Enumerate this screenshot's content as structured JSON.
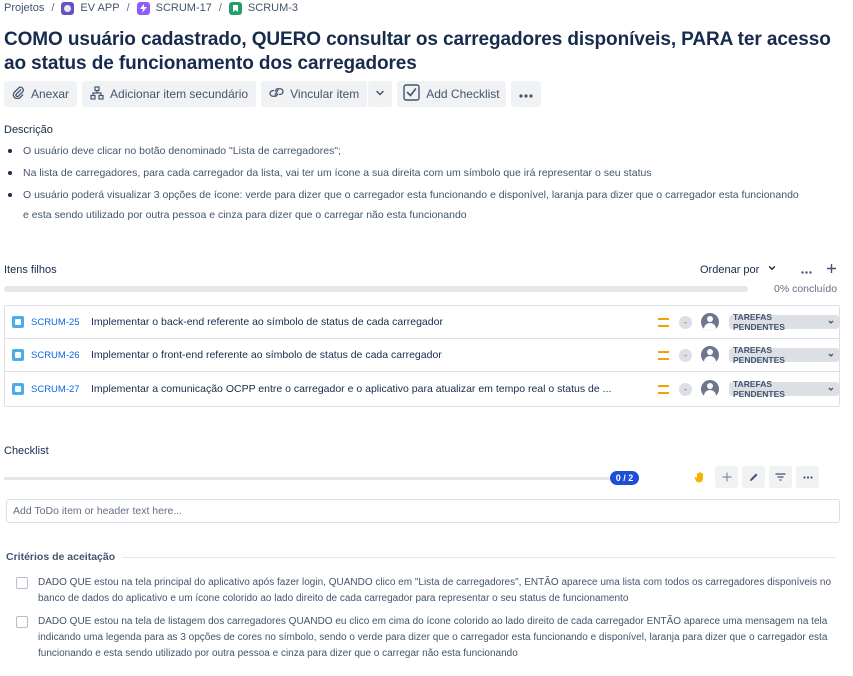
{
  "breadcrumb": {
    "root": "Projetos",
    "project": "EV APP",
    "epic": "SCRUM-17",
    "issue": "SCRUM-3"
  },
  "issue": {
    "title": "COMO usuário cadastrado, QUERO consultar os carregadores disponíveis, PARA ter acesso ao status de funcionamento dos carregadores"
  },
  "toolbar": {
    "attach": "Anexar",
    "add_child": "Adicionar item secundário",
    "link": "Vincular item",
    "add_checklist": "Add Checklist"
  },
  "description": {
    "label": "Descrição",
    "items": [
      "O usuário deve clicar no botão denominado \"Lista de carregadores\";",
      "Na lista de carregadores, para cada carregador da lista, vai ter um ícone a sua direita com um símbolo que irá representar o seu status",
      "O usuário poderá visualizar 3 opções de ícone: verde para dizer que o carregador esta funcionando e disponível, laranja para dizer que o carregador esta funcionando e esta sendo utilizado por outra pessoa e cinza para dizer que o carregar não esta funcionando"
    ]
  },
  "children": {
    "label": "Itens filhos",
    "order_by": "Ordenar por",
    "progress_text": "0% concluído",
    "progress": 0,
    "rows": [
      {
        "key": "SCRUM-25",
        "summary": "Implementar o back-end referente ao símbolo de status de cada carregador",
        "estimate": "-",
        "status": "TAREFAS PENDENTES"
      },
      {
        "key": "SCRUM-26",
        "summary": "Implementar o front-end referente ao símbolo de status de cada carregador",
        "estimate": "-",
        "status": "TAREFAS PENDENTES"
      },
      {
        "key": "SCRUM-27",
        "summary": "Implementar a comunicação OCPP entre o carregador e o aplicativo para atualizar em tempo real o status de ...",
        "estimate": "-",
        "status": "TAREFAS PENDENTES"
      }
    ]
  },
  "checklist": {
    "label": "Checklist",
    "count": "0 / 2",
    "input_placeholder": "Add ToDo item or header text here..."
  },
  "criteria": {
    "label": "Critérios de aceitação",
    "items": [
      "DADO QUE estou na tela principal do aplicativo após fazer login, QUANDO clico em \"Lista de carregadores\", ENTÃO aparece uma lista com todos os carregadores disponíveis no banco de dados do aplicativo e um ícone colorido ao lado direito de cada carregador para representar o seu status de funcionamento",
      "DADO QUE estou na tela de listagem dos carregadores QUANDO eu clico em cima do ícone colorido ao lado direito de cada carregador ENTÃO aparece uma mensagem na tela indicando uma legenda para as 3 opções de cores no símbolo, sendo o verde para dizer que o carregador esta funcionando e disponível, laranja para dizer que o carregador esta funcionando e esta sendo utilizado por outra pessoa e cinza para dizer que o carregar não esta funcionando"
    ]
  },
  "colors": {
    "link": "#0c66e4",
    "priority_medium": "#f2a100",
    "checklist_badge": "#1d4ed8",
    "task_icon": "#4bade8"
  }
}
